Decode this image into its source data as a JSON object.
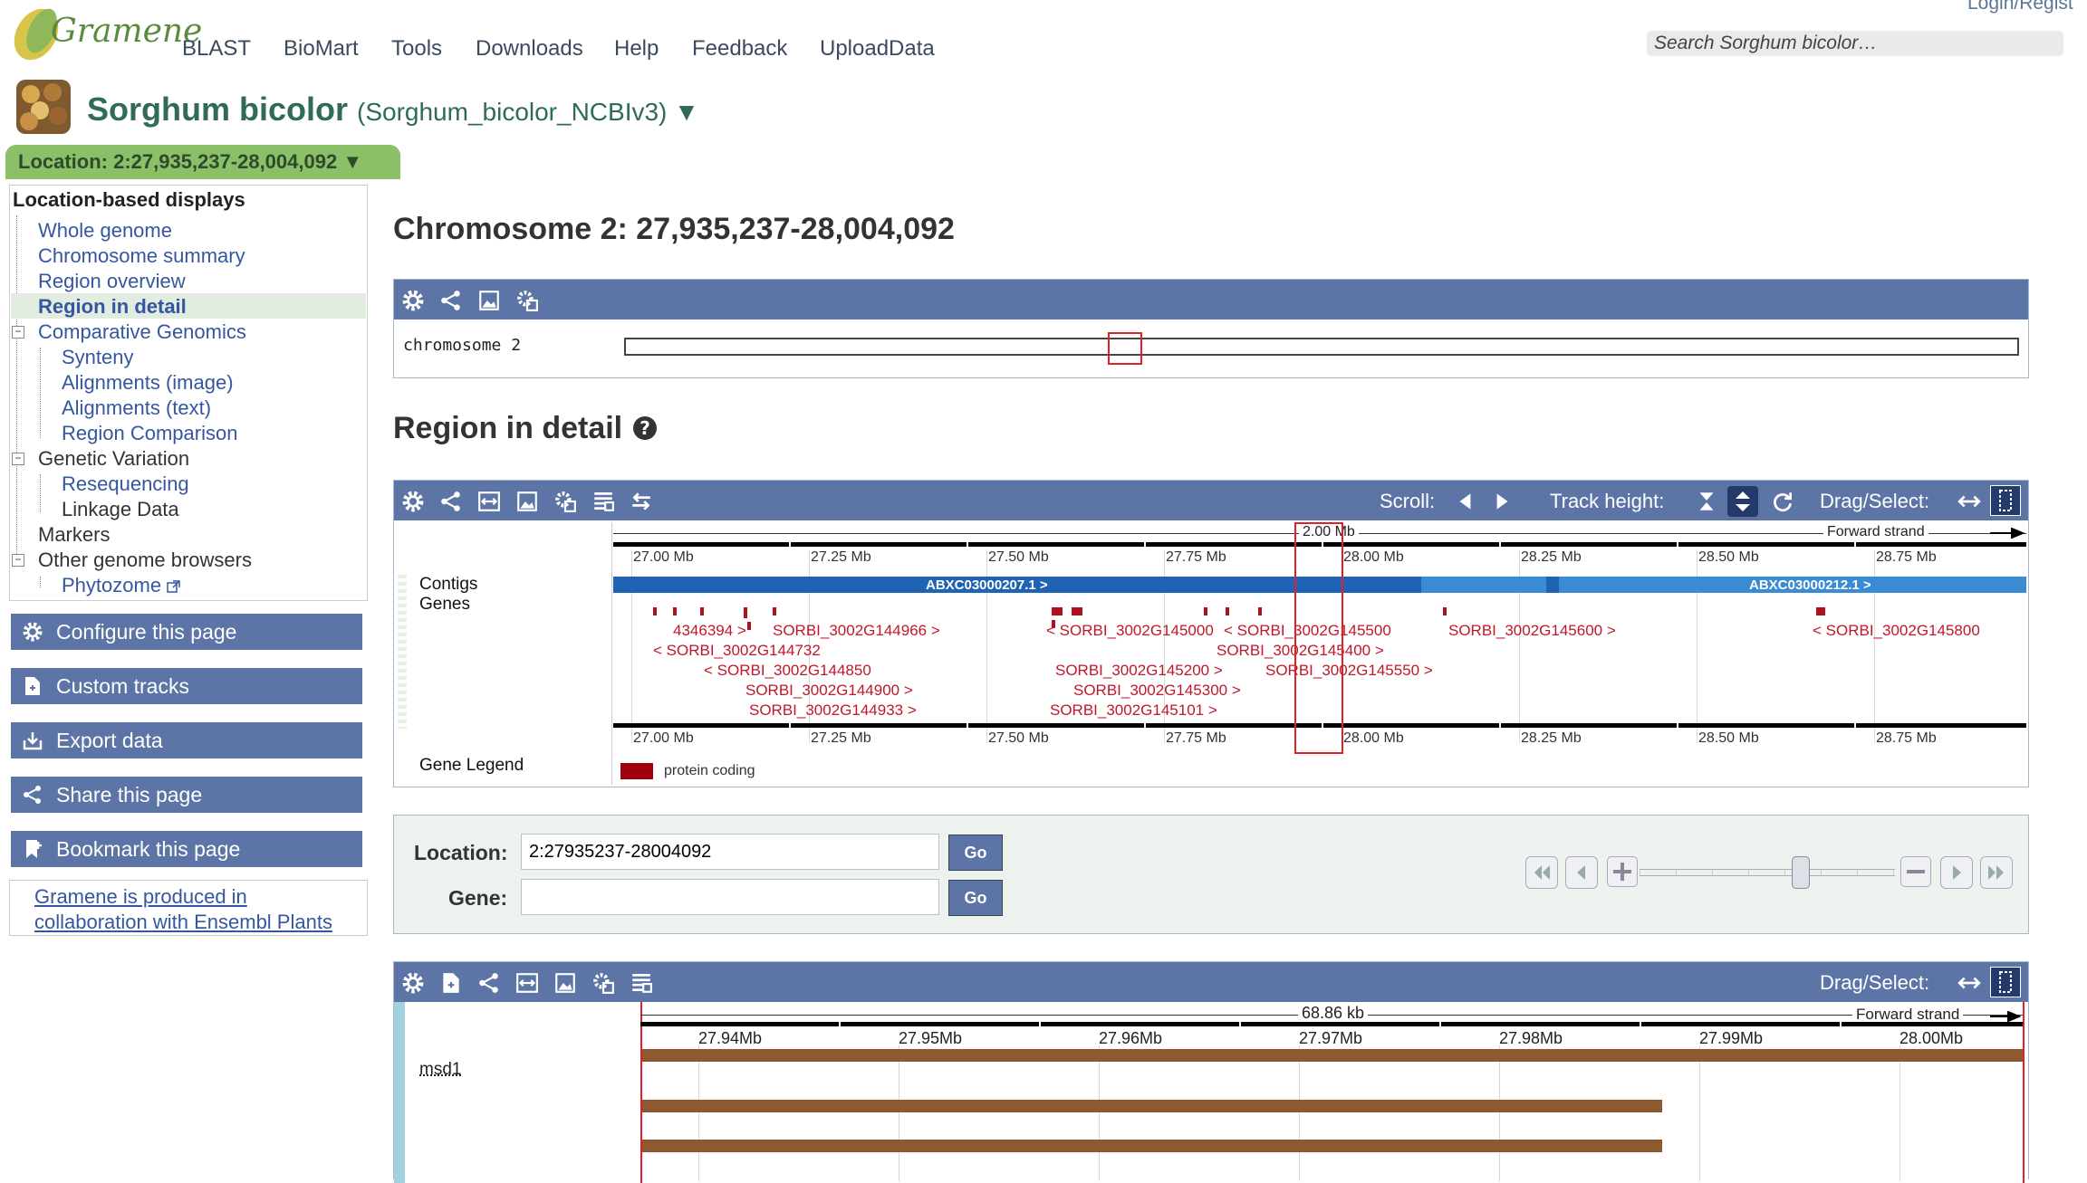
{
  "header": {
    "logo_text": "Gramene",
    "nav": [
      "BLAST",
      "BioMart",
      "Tools",
      "Downloads",
      "Help",
      "Feedback",
      "UploadData"
    ],
    "login": "Login/Regist",
    "search_placeholder": "Search Sorghum bicolor…"
  },
  "species": {
    "name": "Sorghum bicolor",
    "assembly": "(Sorghum_bicolor_NCBIv3) ▼"
  },
  "location_tab": "Location: 2:27,935,237-28,004,092 ▼",
  "sidebar": {
    "heading": "Location-based displays",
    "items": {
      "whole_genome": "Whole genome",
      "chromosome_summary": "Chromosome summary",
      "region_overview": "Region overview",
      "region_in_detail": "Region in detail",
      "comparative_genomics": "Comparative Genomics",
      "synteny": "Synteny",
      "alignments_image": "Alignments (image)",
      "alignments_text": "Alignments (text)",
      "region_comparison": "Region Comparison",
      "genetic_variation": "Genetic Variation",
      "resequencing": "Resequencing",
      "linkage_data": "Linkage Data",
      "markers": "Markers",
      "other_browsers": "Other genome browsers",
      "phytozome": "Phytozome"
    },
    "buttons": {
      "configure": "Configure this page",
      "custom_tracks": "Custom tracks",
      "export": "Export data",
      "share": "Share this page",
      "bookmark": "Bookmark this page"
    },
    "collab_line1": "Gramene is produced in",
    "collab_line2": "collaboration with Ensembl Plants"
  },
  "main": {
    "chrom_title": "Chromosome 2: 27,935,237-28,004,092",
    "chrom_label": "chromosome 2",
    "region_title": "Region in detail",
    "toolbar": {
      "scroll": "Scroll:",
      "track_height": "Track height:",
      "drag_select": "Drag/Select:"
    },
    "region_view": {
      "scale_label": "2.00 Mb",
      "forward_strand": "Forward strand",
      "ticks": [
        "27.00 Mb",
        "27.25 Mb",
        "27.50 Mb",
        "27.75 Mb",
        "28.00 Mb",
        "28.25 Mb",
        "28.50 Mb",
        "28.75 Mb"
      ],
      "contigs_label": "Contigs",
      "genes_label": "Genes",
      "contig_1": "ABXC03000207.1 >",
      "contig_2": "ABXC03000212.1 >",
      "genes": [
        "4346394 >",
        "SORBI_3002G144966 >",
        "< SORBI_3002G144732",
        "< SORBI_3002G144850",
        "SORBI_3002G144900 >",
        "SORBI_3002G144933 >",
        "< SORBI_3002G145000",
        "< SORBI_3002G145500",
        "SORBI_3002G145400 >",
        "SORBI_3002G145200 >",
        "SORBI_3002G145550 >",
        "SORBI_3002G145300 >",
        "SORBI_3002G145101 >",
        "SORBI_3002G145600 >",
        "< SORBI_3002G145800"
      ],
      "gene_legend": "Gene Legend",
      "legend_protein_coding": "protein coding",
      "colors": {
        "contig": "#1f64b4",
        "contig_light": "#3a8ad4",
        "gene": "#b01020",
        "selection": "#e0202a"
      }
    },
    "nav_form": {
      "location_label": "Location:",
      "location_value": "2:27935237-28004092",
      "gene_label": "Gene:",
      "gene_value": "",
      "go": "Go"
    },
    "detail_panel": {
      "drag_select": "Drag/Select:",
      "length": "68.86 kb",
      "forward_strand": "Forward strand",
      "ticks": [
        "27.94Mb",
        "27.95Mb",
        "27.96Mb",
        "27.97Mb",
        "27.98Mb",
        "27.99Mb",
        "28.00Mb"
      ],
      "track_label": "msd1"
    }
  }
}
